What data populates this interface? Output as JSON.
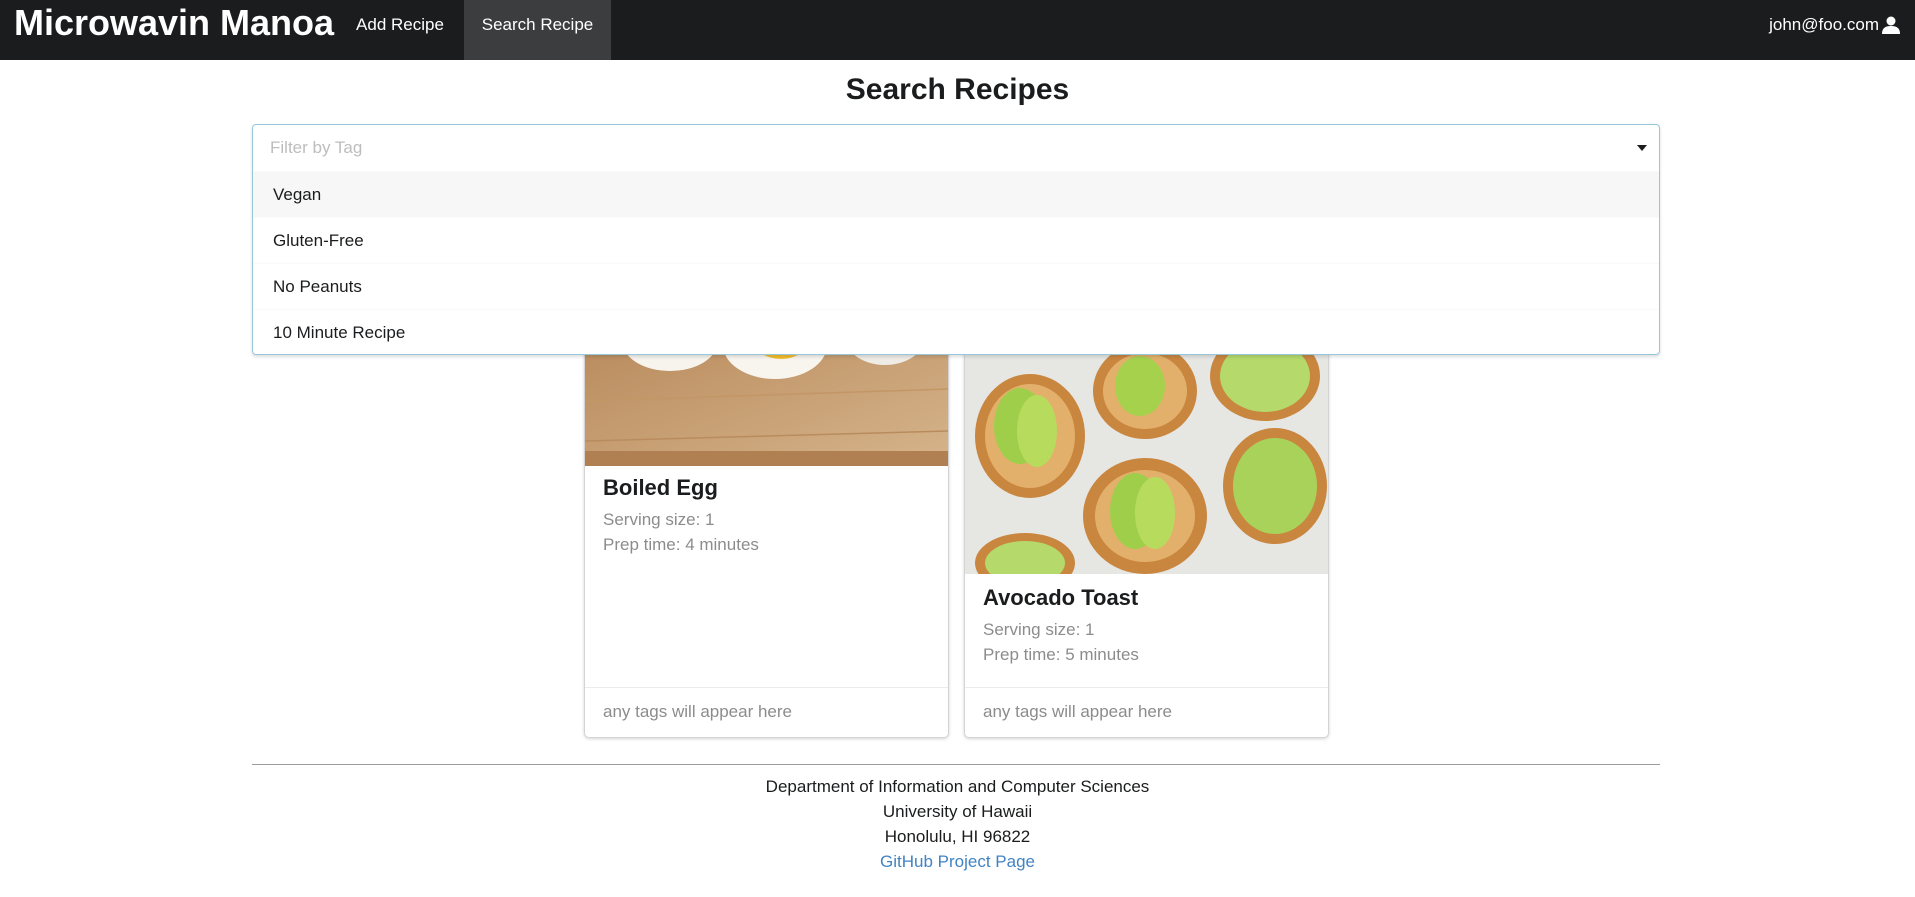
{
  "nav": {
    "brand": "Microwavin Manoa",
    "items": [
      {
        "label": "Add Recipe",
        "active": false
      },
      {
        "label": "Search Recipe",
        "active": true
      }
    ],
    "user_email": "john@foo.com",
    "user_icon": "user-icon"
  },
  "page": {
    "title": "Search Recipes"
  },
  "filter": {
    "placeholder": "Filter by Tag",
    "caret_icon": "dropdown-caret-icon",
    "options": [
      "Vegan",
      "Gluten-Free",
      "No Peanuts",
      "10 Minute Recipe"
    ],
    "highlighted": "Vegan"
  },
  "recipes": [
    {
      "name": "Boiled Egg",
      "serving": "Serving size: 1",
      "prep": "Prep time: 4 minutes",
      "tags_text": "any tags will appear here"
    },
    {
      "name": "Avocado Toast",
      "serving": "Serving size: 1",
      "prep": "Prep time: 5 minutes",
      "tags_text": "any tags will appear here"
    }
  ],
  "footer": {
    "line1": "Department of Information and Computer Sciences",
    "line2": "University of Hawaii",
    "line3": "Honolulu, HI 96822",
    "link": "GitHub Project Page"
  },
  "colors": {
    "topbar": "#1b1c1d",
    "active_nav": "#3c3d3e",
    "link": "#4183c4",
    "dropdown_border": "#96c8da"
  }
}
